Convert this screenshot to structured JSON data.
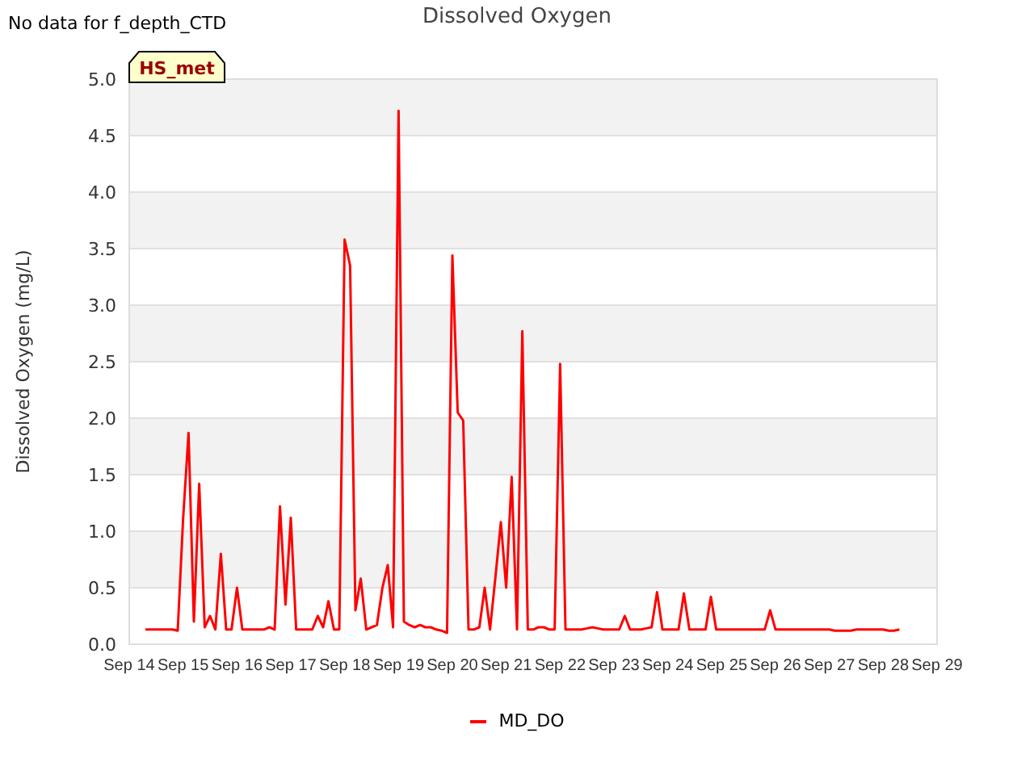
{
  "notice": "No data for f_depth_CTD",
  "chart": {
    "chart_data": {
      "type": "line",
      "title": "Dissolved Oxygen",
      "ylabel": "Dissolved Oxygen (mg/L)",
      "ylim": [
        0,
        5
      ],
      "grid": true,
      "yticks": [
        {
          "value": 0,
          "label": "0.0"
        },
        {
          "value": 0.5,
          "label": "0.5"
        },
        {
          "value": 1,
          "label": "1.0"
        },
        {
          "value": 1.5,
          "label": "1.5"
        },
        {
          "value": 2,
          "label": "2.0"
        },
        {
          "value": 2.5,
          "label": "2.5"
        },
        {
          "value": 3,
          "label": "3.0"
        },
        {
          "value": 3.5,
          "label": "3.5"
        },
        {
          "value": 4,
          "label": "4.0"
        },
        {
          "value": 4.5,
          "label": "4.5"
        },
        {
          "value": 5,
          "label": "5.0"
        }
      ],
      "annotations": [
        {
          "text": "HS_met"
        }
      ],
      "categories": [
        "Sep 14",
        null,
        null,
        null,
        null,
        null,
        null,
        null,
        null,
        null,
        "Sep 15",
        null,
        null,
        null,
        null,
        null,
        null,
        null,
        null,
        null,
        "Sep 16",
        null,
        null,
        null,
        null,
        null,
        null,
        null,
        null,
        null,
        "Sep 17",
        null,
        null,
        null,
        null,
        null,
        null,
        null,
        null,
        null,
        "Sep 18",
        null,
        null,
        null,
        null,
        null,
        null,
        null,
        null,
        null,
        "Sep 19",
        null,
        null,
        null,
        null,
        null,
        null,
        null,
        null,
        null,
        "Sep 20",
        null,
        null,
        null,
        null,
        null,
        null,
        null,
        null,
        null,
        "Sep 21",
        null,
        null,
        null,
        null,
        null,
        null,
        null,
        null,
        null,
        "Sep 22",
        null,
        null,
        null,
        null,
        null,
        null,
        null,
        null,
        null,
        "Sep 23",
        null,
        null,
        null,
        null,
        null,
        null,
        null,
        null,
        null,
        "Sep 24",
        null,
        null,
        null,
        null,
        null,
        null,
        null,
        null,
        null,
        "Sep 25",
        null,
        null,
        null,
        null,
        null,
        null,
        null,
        null,
        null,
        "Sep 26",
        null,
        null,
        null,
        null,
        null,
        null,
        null,
        null,
        null,
        "Sep 27",
        null,
        null,
        null,
        null,
        null,
        null,
        null,
        null,
        null,
        "Sep 28",
        null,
        null,
        null,
        null,
        null,
        null,
        null,
        null,
        null,
        "Sep 29"
      ],
      "series": [
        {
          "name": "MD_DO",
          "color": "#ff0000",
          "values": [
            null,
            null,
            null,
            0.13,
            0.13,
            0.13,
            0.13,
            0.13,
            0.13,
            0.12,
            1.1,
            1.87,
            0.2,
            1.42,
            0.15,
            0.25,
            0.13,
            0.8,
            0.13,
            0.13,
            0.5,
            0.13,
            0.13,
            0.13,
            0.13,
            0.13,
            0.15,
            0.13,
            1.22,
            0.35,
            1.12,
            0.13,
            0.13,
            0.13,
            0.13,
            0.25,
            0.15,
            0.38,
            0.13,
            0.13,
            3.58,
            3.35,
            0.3,
            0.58,
            0.13,
            0.15,
            0.17,
            0.5,
            0.7,
            0.15,
            4.72,
            0.2,
            0.17,
            0.15,
            0.17,
            0.15,
            0.15,
            0.13,
            0.12,
            0.1,
            3.44,
            2.05,
            1.98,
            0.13,
            0.13,
            0.15,
            0.5,
            0.13,
            0.6,
            1.08,
            0.5,
            1.48,
            0.13,
            2.77,
            0.13,
            0.13,
            0.15,
            0.15,
            0.13,
            0.13,
            2.48,
            0.13,
            0.13,
            0.13,
            0.13,
            0.14,
            0.15,
            0.14,
            0.13,
            0.13,
            0.13,
            0.13,
            0.25,
            0.13,
            0.13,
            0.13,
            0.14,
            0.15,
            0.46,
            0.13,
            0.13,
            0.13,
            0.13,
            0.45,
            0.13,
            0.13,
            0.13,
            0.13,
            0.42,
            0.13,
            0.13,
            0.13,
            0.13,
            0.13,
            0.13,
            0.13,
            0.13,
            0.13,
            0.13,
            0.3,
            0.13,
            0.13,
            0.13,
            0.13,
            0.13,
            0.13,
            0.13,
            0.13,
            0.13,
            0.13,
            0.13,
            0.12,
            0.12,
            0.12,
            0.12,
            0.13,
            0.13,
            0.13,
            0.13,
            0.13,
            0.13,
            0.12,
            0.12,
            0.13,
            null,
            null,
            null,
            null,
            null,
            null,
            null
          ]
        }
      ]
    }
  }
}
